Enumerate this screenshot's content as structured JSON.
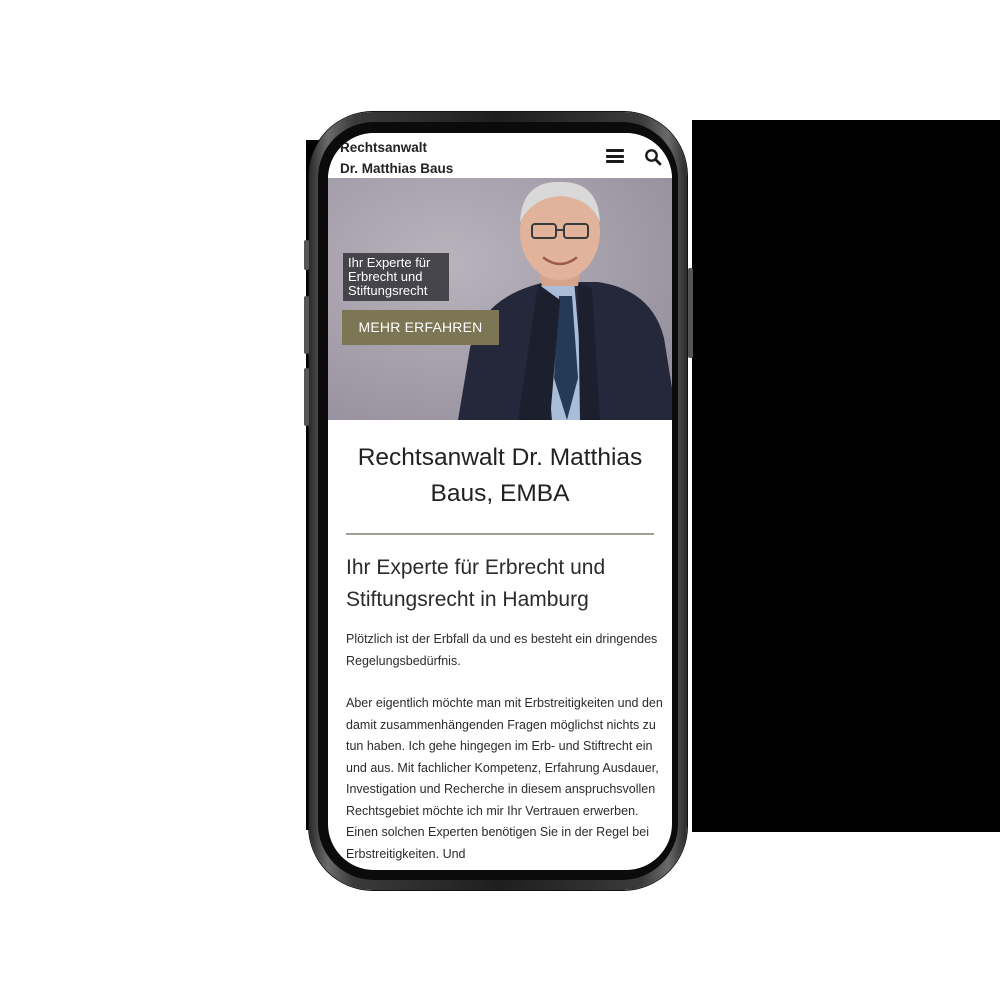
{
  "header": {
    "brand_line1": "Rechtsanwalt",
    "brand_line2": "Dr. Matthias Baus",
    "menu_icon": "hamburger-menu-icon",
    "search_icon": "search-icon"
  },
  "hero": {
    "tagline": "Ihr Experte für Erbrecht und Stiftungsrecht",
    "cta_label": "MEHR ERFAHREN",
    "cta_color": "#7d7655"
  },
  "main": {
    "title": "Rechtsanwalt Dr. Matthias Baus, EMBA",
    "subheading": "Ihr Experte für Erbrecht und Stiftungsrecht in Hamburg",
    "paragraph_1": "Plötzlich ist der Erbfall da und es besteht ein dringendes Regelungsbedürfnis.",
    "paragraph_2": "Aber eigentlich möchte man mit  Erbstreitigkeiten und den damit zusammenhängenden Fragen möglichst nichts zu tun haben. Ich gehe hingegen im Erb- und Stiftrecht ein und aus. Mit fachlicher Kompetenz, Erfahrung Ausdauer, Investigation und Recherche in diesem anspruchsvollen Rechtsgebiet möchte ich mir Ihr Vertrauen erwerben. Einen solchen Experten benötigen Sie in der Regel bei Erbstreitigkeiten. Und"
  }
}
